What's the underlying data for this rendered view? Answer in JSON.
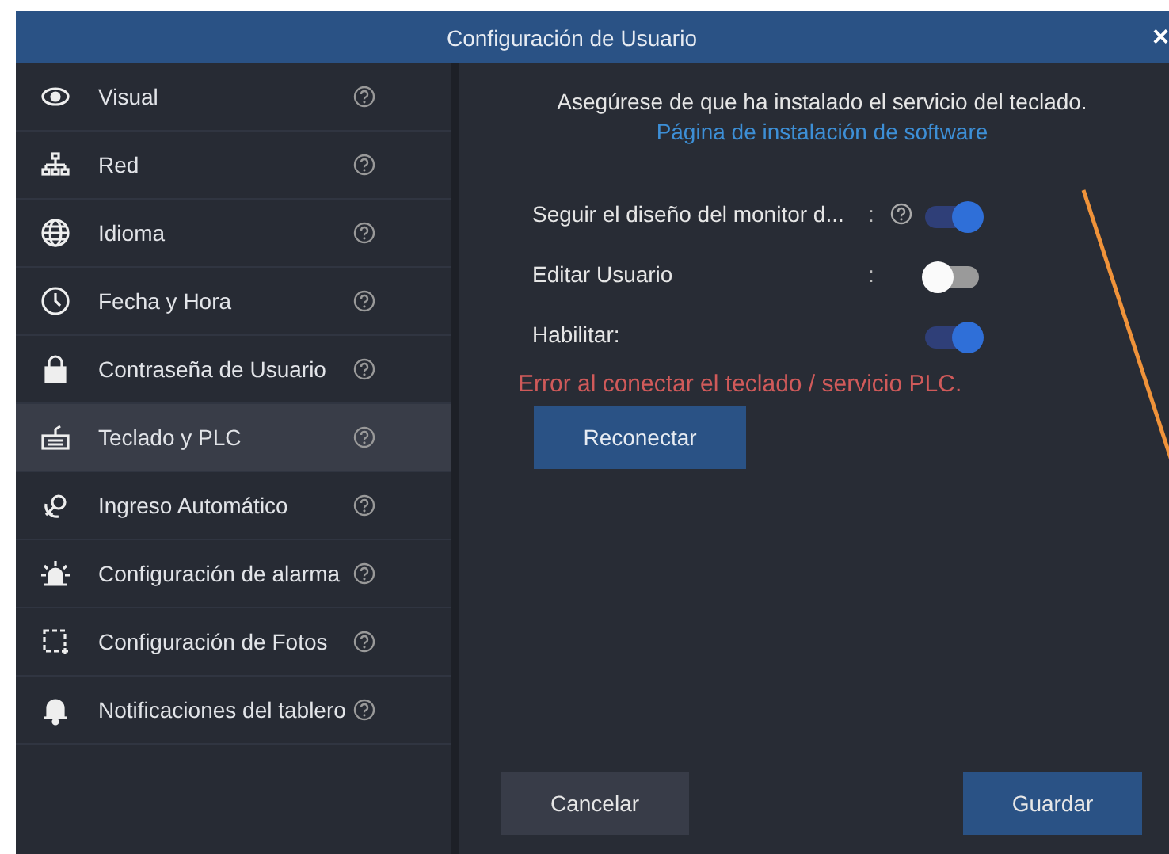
{
  "window": {
    "title": "Configuración de Usuario",
    "close": "×"
  },
  "sidebar": {
    "items": [
      {
        "label": "Visual",
        "selected": false
      },
      {
        "label": "Red",
        "selected": false
      },
      {
        "label": "Idioma",
        "selected": false
      },
      {
        "label": "Fecha y Hora",
        "selected": false
      },
      {
        "label": "Contraseña de Usuario",
        "selected": false
      },
      {
        "label": "Teclado y PLC",
        "selected": true
      },
      {
        "label": "Ingreso Automático",
        "selected": false
      },
      {
        "label": "Configuración de alarma",
        "selected": false
      },
      {
        "label": "Configuración de Fotos",
        "selected": false
      },
      {
        "label": "Notificaciones del tablero",
        "selected": false
      }
    ]
  },
  "content": {
    "notice": "Asegúrese de que ha instalado el servicio del teclado.",
    "link": "Página de instalación de software",
    "settings": [
      {
        "label": "Seguir el diseño del monitor d...",
        "separator": ":",
        "help": true,
        "on": true
      },
      {
        "label": "Editar Usuario",
        "separator": ":",
        "help": false,
        "on": false
      },
      {
        "label": "Habilitar:",
        "help": false,
        "on": true
      }
    ],
    "error": "Error al conectar el teclado / servicio PLC.",
    "reconnect_button": "Reconectar"
  },
  "footer": {
    "buttons": [
      {
        "label": "Cancelar",
        "kind": "secondary"
      },
      {
        "label": "Guardar",
        "kind": "primary"
      }
    ]
  }
}
